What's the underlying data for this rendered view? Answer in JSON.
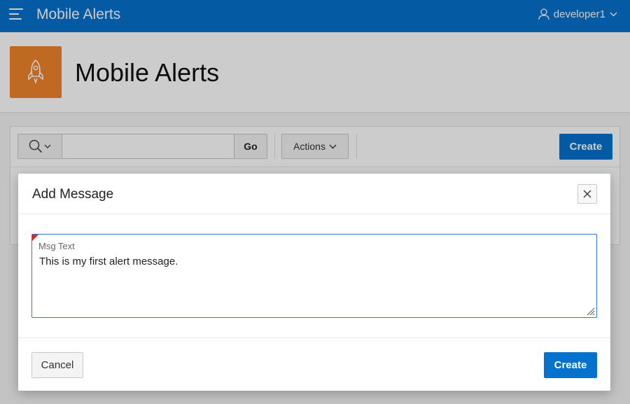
{
  "app": {
    "title": "Mobile Alerts",
    "user": "developer1"
  },
  "hero": {
    "title": "Mobile Alerts",
    "icon": "rocket-icon",
    "icon_bg": "#f0842c"
  },
  "toolbar": {
    "search_placeholder": "",
    "go_label": "Go",
    "actions_label": "Actions",
    "create_label": "Create"
  },
  "dialog": {
    "title": "Add Message",
    "field_label": "Msg Text",
    "field_value": "This is my first alert message.",
    "cancel_label": "Cancel",
    "create_label": "Create"
  },
  "colors": {
    "header": "#0572ce",
    "primary_button": "#0572ce",
    "required_marker": "#e52323"
  }
}
